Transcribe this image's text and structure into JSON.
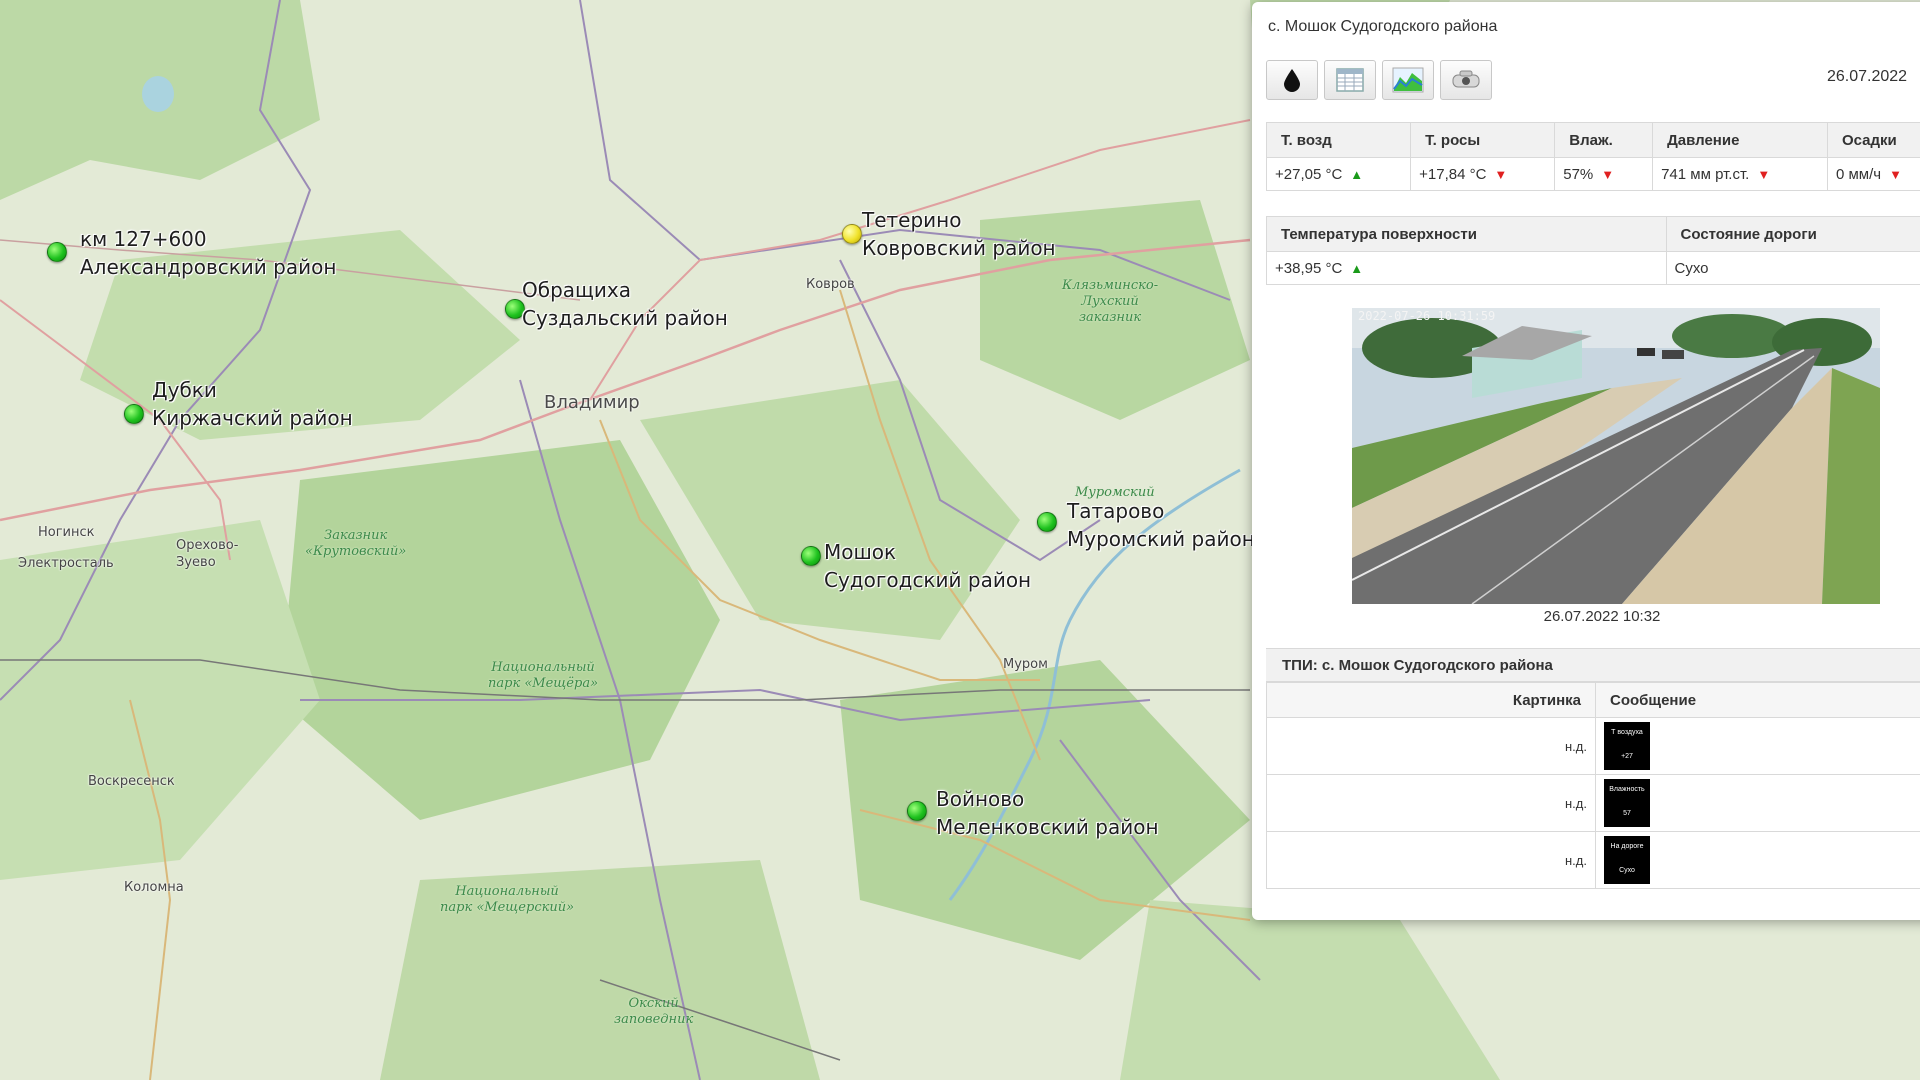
{
  "map": {
    "stations": [
      {
        "line1": "км 127+600",
        "line2": "Александровский район",
        "status": "green"
      },
      {
        "line1": "Обращиха",
        "line2": "Суздальский район",
        "status": "green"
      },
      {
        "line1": "Тетерино",
        "line2": "Ковровский район",
        "status": "yellow"
      },
      {
        "line1": "Дубки",
        "line2": "Киржачский район",
        "status": "green"
      },
      {
        "line1": "Мошок",
        "line2": "Судогодский район",
        "status": "green"
      },
      {
        "line1": "Татарово",
        "line2": "Муромский район",
        "status": "green"
      },
      {
        "line1": "Войново",
        "line2": "Меленковский район",
        "status": "green"
      }
    ],
    "cities": {
      "vladimir": "Владимир",
      "kovrov": "Ковров",
      "murom": "Муром",
      "noginsk": "Ногинск",
      "orekhovo1": "Орехово-",
      "orekhovo2": "Зуево",
      "elektrostal": "Электросталь",
      "voskresensk": "Воскресенск",
      "kolomna": "Коломна"
    },
    "parks": {
      "klyazma": "Клязьминско-\nЛухский\nзаказник",
      "krutovsky": "Заказник\n«Крутовский»",
      "meshchera": "Национальный\nпарк «Мещёра»",
      "meshchersky": "Национальный\nпарк «Мещерский»",
      "oksky": "Окский\nзаповедник",
      "muromsky": "Муромский"
    }
  },
  "panel": {
    "title": "с. Мошок Судогодского района",
    "date": "26.07.2022",
    "toolbar": [
      "drop-icon",
      "table-icon",
      "chart-icon",
      "camera-icon"
    ],
    "weather": {
      "headers": [
        "Т. возд",
        "Т. росы",
        "Влаж.",
        "Давление",
        "Осадки"
      ],
      "values": [
        "+27,05 °C",
        "+17,84 °C",
        "57%",
        "741 мм рт.ст.",
        "0 мм/ч"
      ],
      "trends": [
        "up",
        "down",
        "down",
        "down",
        "down"
      ]
    },
    "road": {
      "headers": [
        "Температура поверхности",
        "Состояние дороги"
      ],
      "values": [
        "+38,95 °C",
        "Сухо"
      ],
      "trend": "up"
    },
    "camera": {
      "timestamp_overlay": "2022-07-26 10:31:59",
      "caption": "26.07.2022 10:32"
    },
    "tpi": {
      "title": "ТПИ: с. Мошок Судогодского района",
      "headers": [
        "Картинка",
        "Сообщение"
      ],
      "rows": [
        {
          "picture": "н.д.",
          "line1": "Т воздуха",
          "line2": "+27"
        },
        {
          "picture": "н.д.",
          "line1": "Влажность",
          "line2": "57"
        },
        {
          "picture": "н.д.",
          "line1": "На дороге",
          "line2": "Сухо"
        }
      ]
    }
  },
  "colors": {
    "marker_green": "#1fc21f",
    "marker_yellow": "#f0e22a",
    "trend_up": "#1a9a1a",
    "trend_down": "#e02020"
  }
}
